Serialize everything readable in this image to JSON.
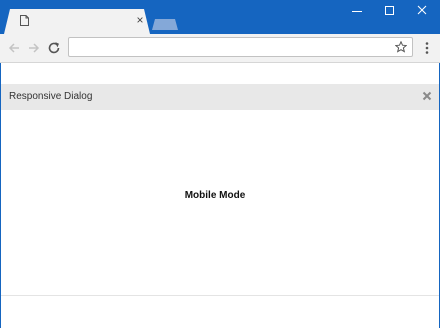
{
  "browser": {
    "tab": {
      "close_label": "×",
      "favicon": "page-icon"
    },
    "window_controls": {
      "minimize": "—",
      "maximize": "☐",
      "close": "✕"
    },
    "toolbar": {
      "icons": [
        "back-arrow-icon",
        "forward-arrow-icon",
        "reload-icon",
        "bookmark-star-icon",
        "menu-kebab-icon"
      ],
      "address_value": ""
    },
    "colors": {
      "titlebar": "#1565c0",
      "toolbar": "#f2f2f2"
    }
  },
  "dialog": {
    "title": "Responsive Dialog",
    "close_label": "×",
    "content": "Mobile Mode",
    "colors": {
      "header": "#e8e8e8"
    }
  }
}
